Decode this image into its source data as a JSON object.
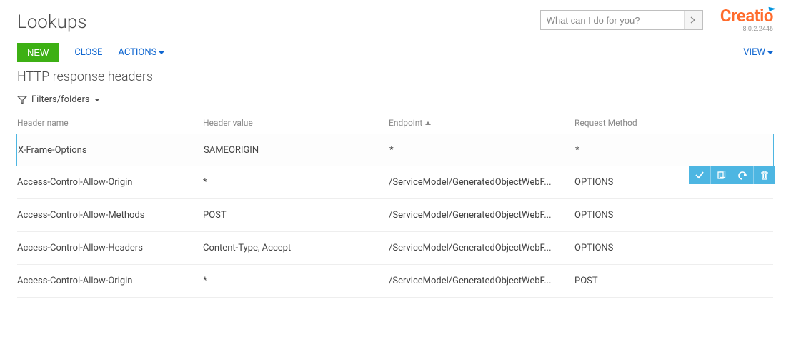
{
  "header": {
    "title": "Lookups",
    "search_placeholder": "What can I do for you?",
    "brand": "Creatio",
    "version": "8.0.2.2446"
  },
  "toolbar": {
    "new_label": "NEW",
    "close_label": "CLOSE",
    "actions_label": "ACTIONS",
    "view_label": "VIEW"
  },
  "section": {
    "subtitle": "HTTP response headers",
    "filters_label": "Filters/folders"
  },
  "grid": {
    "columns": {
      "header_name": "Header name",
      "header_value": "Header value",
      "endpoint": "Endpoint",
      "request_method": "Request Method"
    },
    "sort_column": "endpoint",
    "rows": [
      {
        "header_name": "X-Frame-Options",
        "header_value": "SAMEORIGIN",
        "endpoint": "*",
        "request_method": "*",
        "selected": true
      },
      {
        "header_name": "Access-Control-Allow-Origin",
        "header_value": "*",
        "endpoint": "/ServiceModel/GeneratedObjectWebF...",
        "request_method": "OPTIONS"
      },
      {
        "header_name": "Access-Control-Allow-Methods",
        "header_value": "POST",
        "endpoint": "/ServiceModel/GeneratedObjectWebF...",
        "request_method": "OPTIONS"
      },
      {
        "header_name": "Access-Control-Allow-Headers",
        "header_value": "Content-Type, Accept",
        "endpoint": "/ServiceModel/GeneratedObjectWebF...",
        "request_method": "OPTIONS"
      },
      {
        "header_name": "Access-Control-Allow-Origin",
        "header_value": "*",
        "endpoint": "/ServiceModel/GeneratedObjectWebF...",
        "request_method": "POST"
      }
    ]
  }
}
